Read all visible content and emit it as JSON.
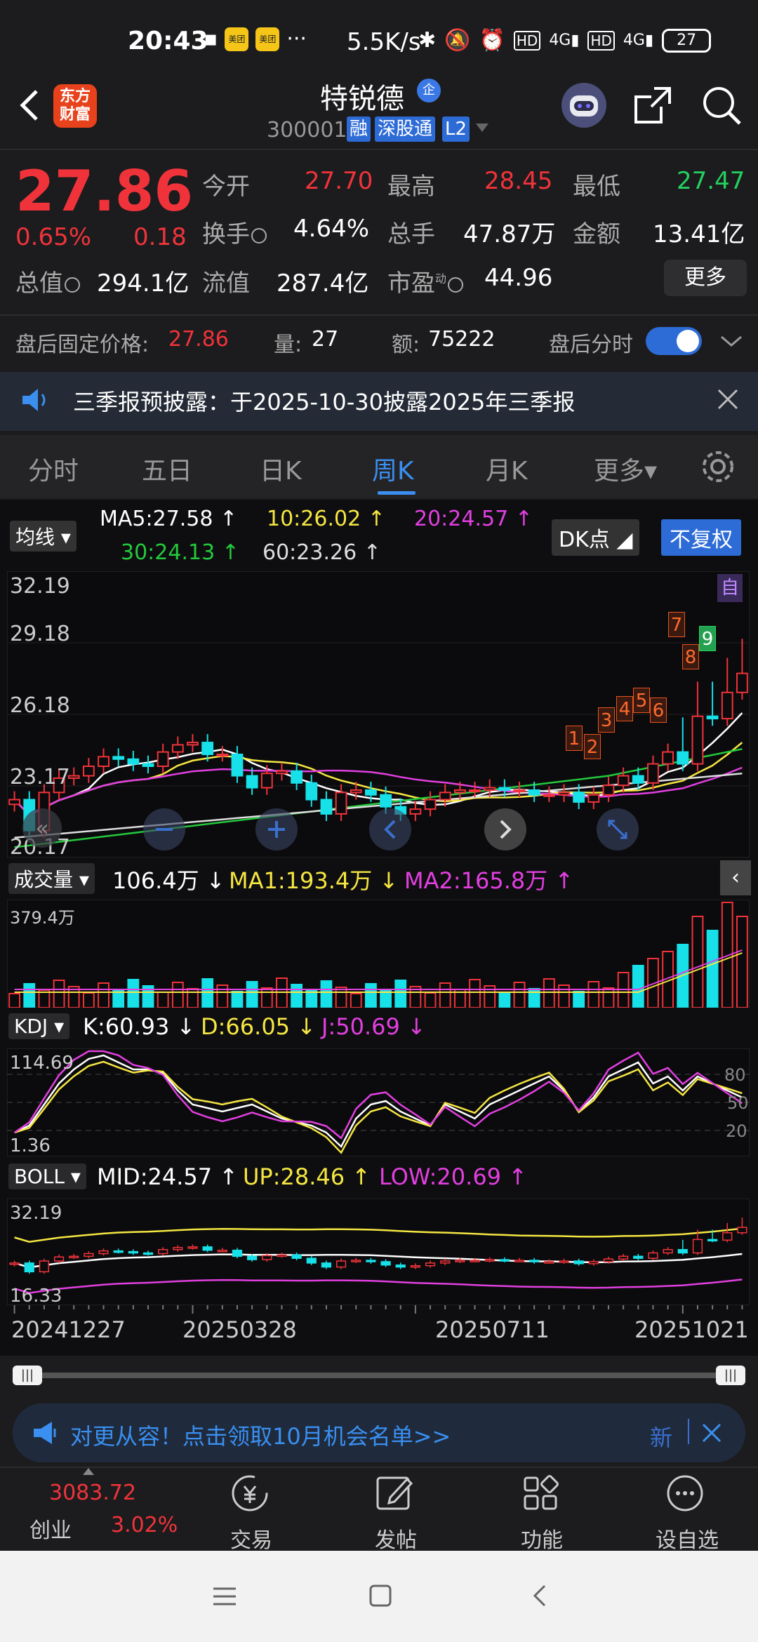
{
  "status_bar": {
    "time": "20:43",
    "speed": "5.5K/s",
    "net1": "4G",
    "net2": "4G",
    "hd": "HD",
    "battery": "27",
    "app1": "美团",
    "app2": "美团"
  },
  "header": {
    "logo_text": "东方财富",
    "stock_name": "特锐德",
    "badge": "企",
    "code": "300001",
    "tags": [
      "融",
      "深股通",
      "L2"
    ]
  },
  "quote": {
    "price": "27.86",
    "change_pct": "0.65%",
    "change": "0.18",
    "open_label": "今开",
    "open": "27.70",
    "high_label": "最高",
    "high": "28.45",
    "low_label": "最低",
    "low": "27.47",
    "turnover_label": "换手",
    "turnover": "4.64%",
    "volume_label": "总手",
    "volume": "47.87万",
    "amount_label": "金额",
    "amount": "13.41亿",
    "mktcap_label": "总值",
    "mktcap": "294.1亿",
    "float_label": "流值",
    "float": "287.4亿",
    "pe_label": "市盈",
    "pe_sup": "动",
    "pe": "44.96",
    "more": "更多"
  },
  "after_hours": {
    "label": "盘后固定价格:",
    "price": "27.86",
    "vol_label": "量:",
    "vol": "27",
    "amt_label": "额:",
    "amt": "75222",
    "toggle_label": "盘后分时"
  },
  "notice": {
    "text": "三季报预披露：于2025-10-30披露2025年三季报"
  },
  "tabs": [
    "分时",
    "五日",
    "日K",
    "周K",
    "月K",
    "更多"
  ],
  "ma": {
    "selector": "均线",
    "ma5": "MA5:27.58",
    "ma10": "10:26.02",
    "ma20": "20:24.57",
    "ma30": "30:24.13",
    "ma60": "60:23.26",
    "dk": "DK点",
    "fq": "不复权",
    "auto": "自"
  },
  "price_axis": [
    "32.19",
    "29.18",
    "26.18",
    "23.17",
    "20.17"
  ],
  "td_marks": [
    "1",
    "2",
    "3",
    "4",
    "5",
    "6",
    "7",
    "8",
    "9"
  ],
  "volume": {
    "selector": "成交量",
    "value": "106.4万",
    "ma1": "MA1:193.4万",
    "ma2": "MA2:165.8万",
    "max": "379.4万"
  },
  "kdj": {
    "selector": "KDJ",
    "k": "K:60.93",
    "d": "D:66.05",
    "j": "J:50.69",
    "top": "114.69",
    "bottom": "1.36",
    "levels": [
      "80",
      "50",
      "20"
    ]
  },
  "boll": {
    "selector": "BOLL",
    "mid": "MID:24.57",
    "up": "UP:28.46",
    "low": "LOW:20.69",
    "top": "32.19",
    "bottom": "16.33"
  },
  "dates": [
    "20241227",
    "20250328",
    "20250711",
    "20251021"
  ],
  "ad": {
    "text": "对更从容！点击领取10月机会名单>>",
    "tag": "新"
  },
  "bottom_nav": {
    "index_value": "3083.72",
    "index_name": "创业",
    "index_pct": "3.02%",
    "items": [
      "交易",
      "发帖",
      "功能",
      "设自选"
    ]
  },
  "colors": {
    "up": "#f0333a",
    "down": "#17e0e8",
    "accent": "#3a8ff0",
    "ma5": "#ffffff",
    "ma10": "#f5e642",
    "ma20": "#e23fe0",
    "ma30": "#23c93c",
    "ma60": "#dddddd"
  },
  "chart_data": {
    "type": "candlestick",
    "period": "weekly",
    "ylim": [
      20.17,
      32.19
    ],
    "x_ticks": [
      "20241227",
      "20250328",
      "20250711",
      "20251021"
    ],
    "close_estimates": [
      22.6,
      21.3,
      22.9,
      23.5,
      23.6,
      24.0,
      24.4,
      24.3,
      24.1,
      24.0,
      24.6,
      24.9,
      25.0,
      24.5,
      24.5,
      23.6,
      23.1,
      23.7,
      23.8,
      23.3,
      22.6,
      22.0,
      22.9,
      23.0,
      22.8,
      22.3,
      22.0,
      22.2,
      22.6,
      22.9,
      23.0,
      23.0,
      23.1,
      23.0,
      23.0,
      22.8,
      22.8,
      22.9,
      22.5,
      22.8,
      23.2,
      23.6,
      23.3,
      24.1,
      24.6,
      24.1,
      26.1,
      26.0,
      27.1,
      27.9
    ],
    "last_close": 27.86
  }
}
